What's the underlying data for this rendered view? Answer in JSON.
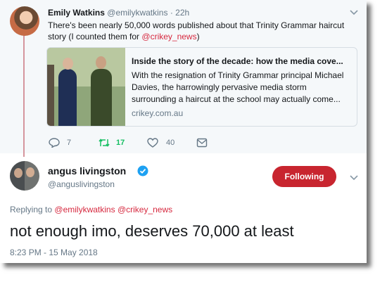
{
  "parent_tweet": {
    "name": "Emily Watkins",
    "handle": "@emilykwatkins",
    "separator": "·",
    "time": "22h",
    "text_before": "There's been nearly 50,000 words published about that Trinity Grammar haircut story (I counted them for ",
    "mention": "@crikey_news",
    "text_after": ")",
    "link_card": {
      "title": "Inside the story of the decade: how the media cove...",
      "description": "With the resignation of Trinity Grammar principal Michael Davies, the harrowingly pervasive media storm surrounding a haircut at the school may actually come...",
      "domain": "crikey.com.au"
    },
    "actions": {
      "replies": "7",
      "retweets": "17",
      "likes": "40"
    },
    "colors": {
      "retweet": "#17bf63",
      "mention": "#d6283e"
    }
  },
  "reply_tweet": {
    "name": "angus livingston",
    "handle": "@anguslivingston",
    "follow_label": "Following",
    "replying_to_label": "Replying to",
    "replying_to_1": "@emilykwatkins",
    "replying_to_2": "@crikey_news",
    "text": "not enough imo, deserves 70,000 at least",
    "timestamp": "8:23 PM - 15 May 2018",
    "colors": {
      "follow_button": "#c8252f",
      "verified": "#1da1f2"
    }
  },
  "icons": [
    "avatar",
    "chevron-down-icon",
    "reply-icon",
    "retweet-icon",
    "like-icon",
    "message-icon",
    "verified-icon"
  ]
}
